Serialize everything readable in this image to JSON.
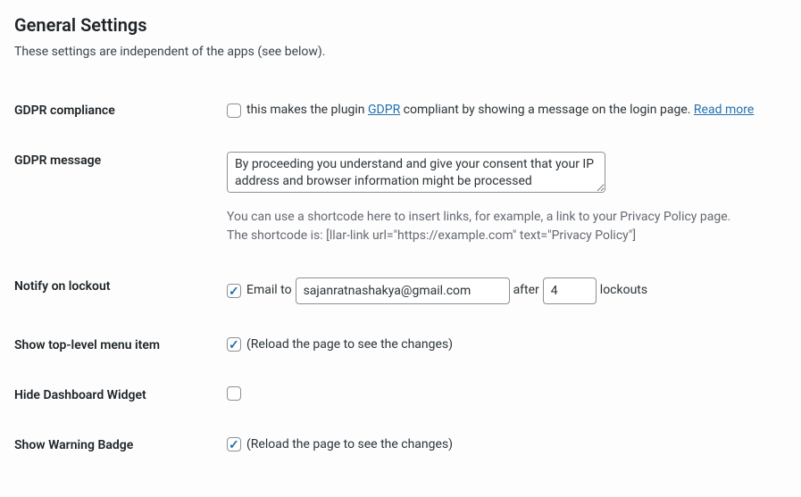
{
  "title": "General Settings",
  "subtitle": "These settings are independent of the apps (see below).",
  "rows": {
    "gdpr_compliance": {
      "label": "GDPR compliance",
      "text1": "this makes the plugin ",
      "link_gdpr": "GDPR",
      "text2": " compliant by showing a message on the login page. ",
      "link_read_more": "Read more"
    },
    "gdpr_message": {
      "label": "GDPR message",
      "value": "By proceeding you understand and give your consent that your IP address and browser information might be processed",
      "desc1": "You can use a shortcode here to insert links, for example, a link to your Privacy Policy page.",
      "desc2": "The shortcode is: [llar-link url=\"https://example.com\" text=\"Privacy Policy\"]"
    },
    "notify": {
      "label": "Notify on lockout",
      "email_to": "Email to",
      "email_value": "sajanratnashakya@gmail.com",
      "after": "after",
      "count_value": "4",
      "lockouts": "lockouts"
    },
    "toplevel": {
      "label": "Show top-level menu item",
      "note": "(Reload the page to see the changes)"
    },
    "hide_dash": {
      "label": "Hide Dashboard Widget"
    },
    "warning_badge": {
      "label": "Show Warning Badge",
      "note": "(Reload the page to see the changes)"
    }
  }
}
